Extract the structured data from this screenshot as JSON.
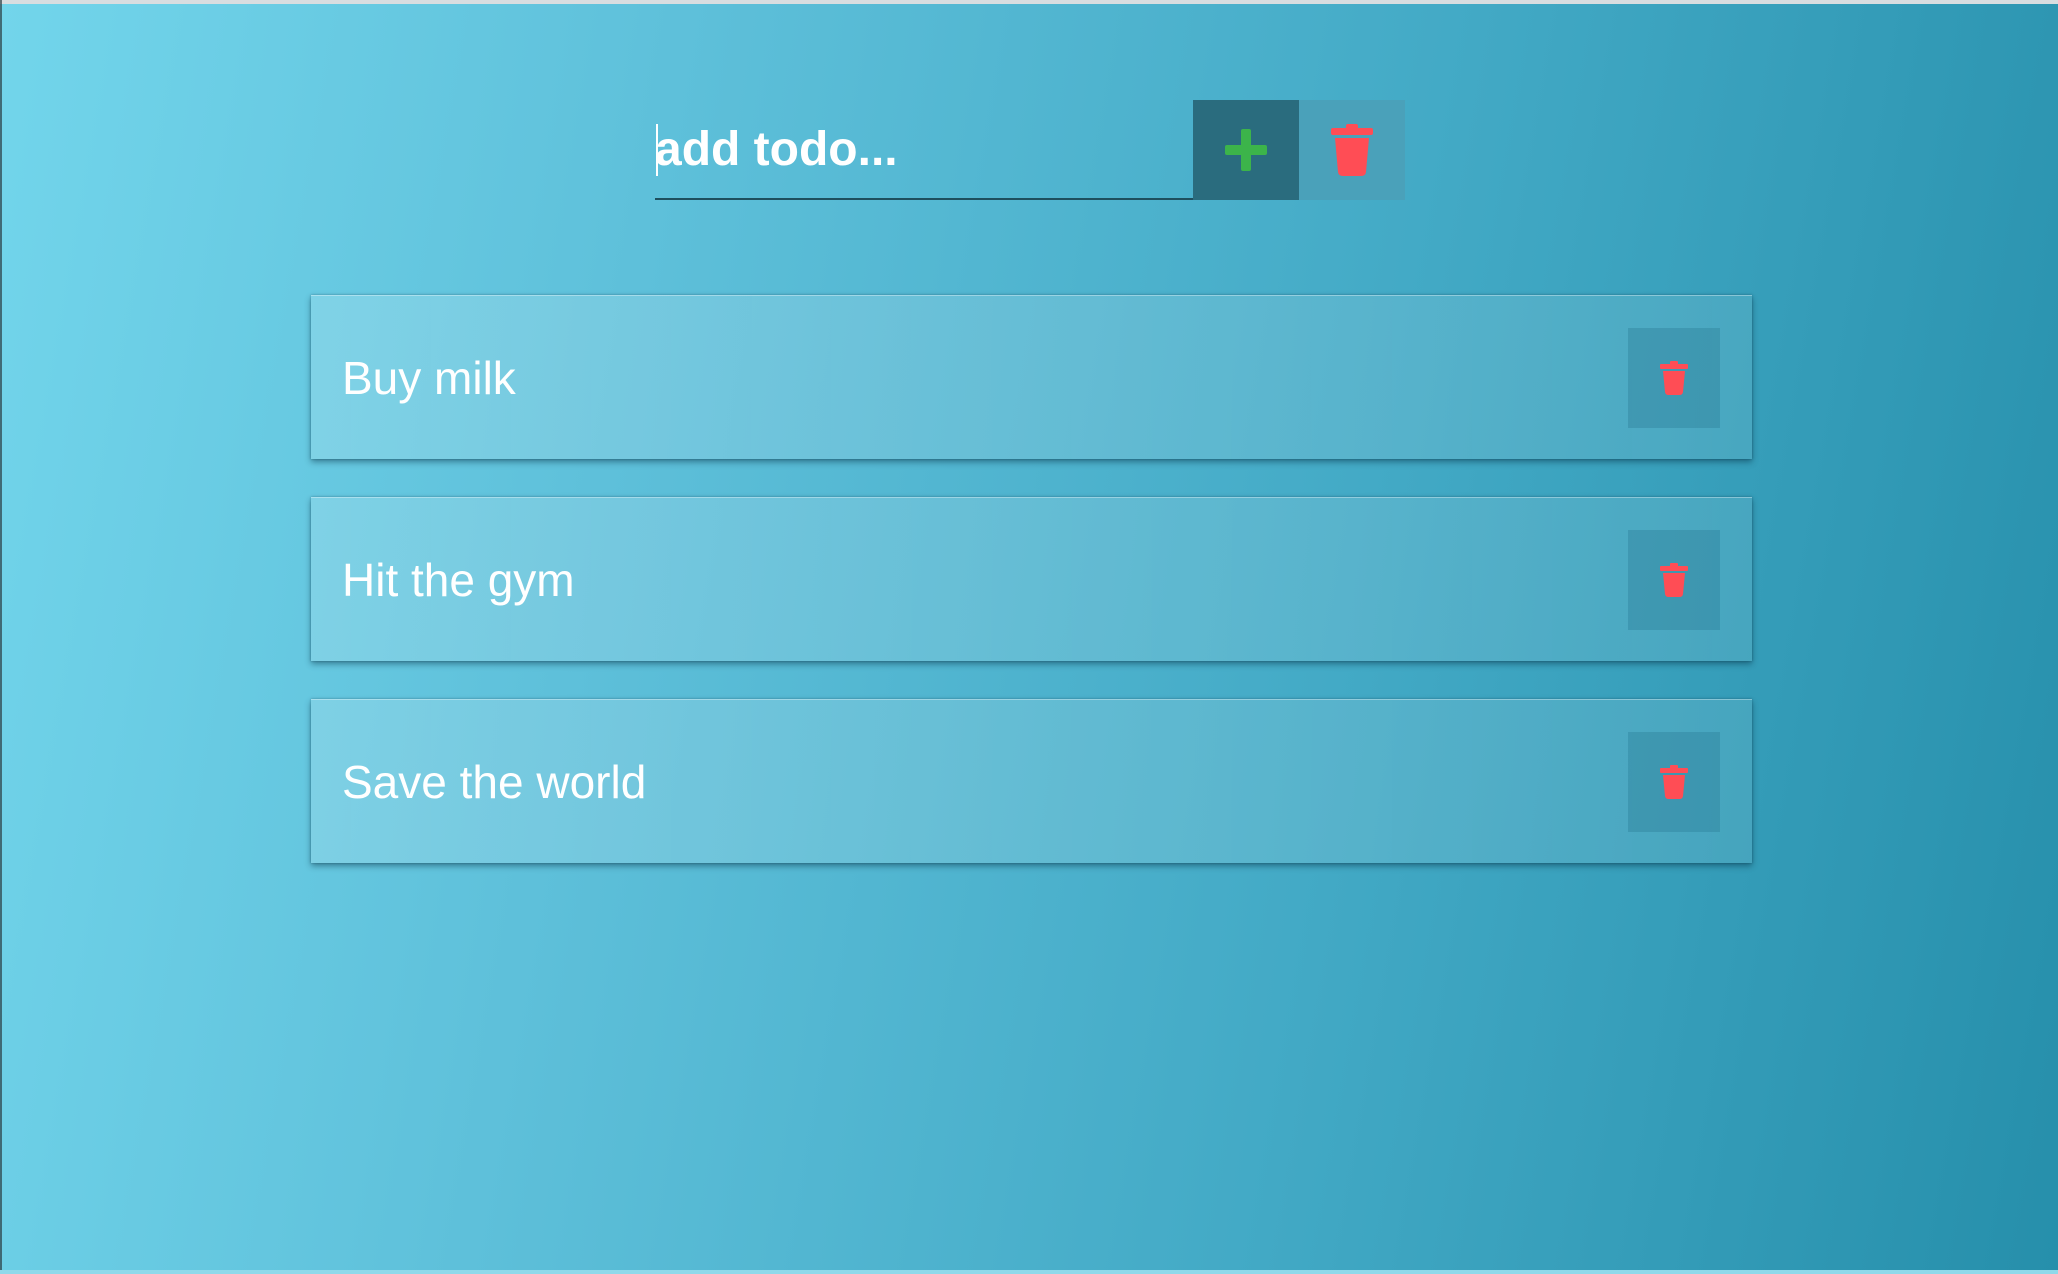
{
  "input": {
    "placeholder": "add todo...",
    "value": ""
  },
  "buttons": {
    "add_icon": "plus-icon",
    "clear_icon": "trash-icon"
  },
  "todos": [
    {
      "text": "Buy milk",
      "delete_icon": "trash-icon"
    },
    {
      "text": "Hit the gym",
      "delete_icon": "trash-icon"
    },
    {
      "text": "Save the world",
      "delete_icon": "trash-icon"
    }
  ],
  "colors": {
    "add_icon": "#3cb44a",
    "delete_icon": "#ff4d55",
    "background_start": "#72d5eb",
    "background_end": "#268fab",
    "add_button_bg": "#2a6c7e"
  }
}
